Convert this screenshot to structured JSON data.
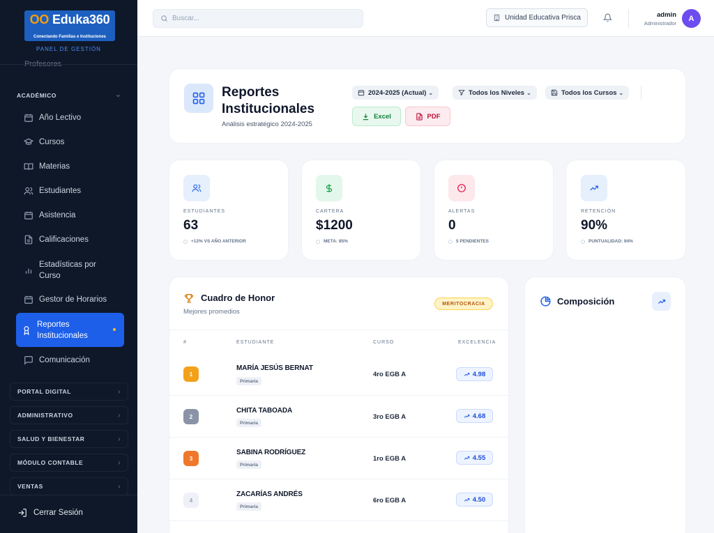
{
  "brand": {
    "name_prefix": "OO",
    "name": "Eduka360",
    "tagline": "Conectando Familias e Instituciones",
    "panel": "PANEL DE GESTIÓN"
  },
  "sidebar": {
    "cut_item": "Profesores",
    "open_section": "ACADÉMICO",
    "items": [
      {
        "label": "Año Lectivo",
        "icon": "calendar-icon"
      },
      {
        "label": "Cursos",
        "icon": "graduation-cap-icon"
      },
      {
        "label": "Materias",
        "icon": "book-open-icon"
      },
      {
        "label": "Estudiantes",
        "icon": "users-icon"
      },
      {
        "label": "Asistencia",
        "icon": "calendar-icon"
      },
      {
        "label": "Calificaciones",
        "icon": "file-text-icon"
      },
      {
        "label": "Estadísticas por Curso",
        "icon": "bar-chart-icon"
      },
      {
        "label": "Gestor de Horarios",
        "icon": "calendar-icon"
      },
      {
        "label": "Reportes Institucionales",
        "icon": "award-icon",
        "active": true
      },
      {
        "label": "Comunicación",
        "icon": "message-square-icon"
      }
    ],
    "sections": [
      "PORTAL DIGITAL",
      "ADMINISTRATIVO",
      "SALUD Y BIENESTAR",
      "MÓDULO CONTABLE",
      "VENTAS"
    ],
    "logout": "Cerrar Sesión"
  },
  "topbar": {
    "search_placeholder": "Buscar...",
    "institution": "Unidad Educativa Prisca",
    "user_name": "admin",
    "user_role": "Administrador",
    "avatar_initial": "A"
  },
  "header": {
    "title": "Reportes Institucionales",
    "subtitle": "Análisis estratégico 2024-2025",
    "filters": {
      "year": "2024-2025 (Actual)",
      "levels": "Todos los Niveles",
      "courses": "Todos los Cursos"
    },
    "export_excel": "Excel",
    "export_pdf": "PDF"
  },
  "stats": [
    {
      "label": "ESTUDIANTES",
      "value": "63",
      "note": "+12% VS AÑO ANTERIOR",
      "icon": "users-icon",
      "color": "#2563eb",
      "bg": "#e6effc"
    },
    {
      "label": "CARTERA",
      "value": "$1200",
      "note": "META: 85%",
      "icon": "dollar-icon",
      "color": "#16a34a",
      "bg": "#e4f7ec"
    },
    {
      "label": "ALERTAS",
      "value": "0",
      "note": "5 PENDIENTES",
      "icon": "alert-circle-icon",
      "color": "#e11d48",
      "bg": "#fde8ec"
    },
    {
      "label": "RETENCIÓN",
      "value": "90%",
      "note": "PUNTUALIDAD: 94%",
      "icon": "trending-up-icon",
      "color": "#2563eb",
      "bg": "#e6effc"
    }
  ],
  "honor": {
    "title": "Cuadro de Honor",
    "subtitle": "Mejores promedios",
    "badge": "MERITOCRACIA",
    "columns": [
      "#",
      "ESTUDIANTE",
      "CURSO",
      "EXCELENCIA"
    ],
    "rows": [
      {
        "rank": "1",
        "name": "MARÍA JESÚS BERNAT",
        "level": "Primaria",
        "course": "4ro EGB A",
        "score": "4.98",
        "color": "#f4a11a"
      },
      {
        "rank": "2",
        "name": "CHITA TABOADA",
        "level": "Primaria",
        "course": "3ro EGB A",
        "score": "4.68",
        "color": "#8a94a6"
      },
      {
        "rank": "3",
        "name": "SABINA RODRÍGUEZ",
        "level": "Primaria",
        "course": "1ro EGB A",
        "score": "4.55",
        "color": "#f0782a"
      },
      {
        "rank": "4",
        "name": "ZACARÍAS ANDRÉS",
        "level": "Primaria",
        "course": "6ro EGB A",
        "score": "4.50",
        "color": "#eef1f6"
      }
    ]
  },
  "composition": {
    "title": "Composición"
  }
}
